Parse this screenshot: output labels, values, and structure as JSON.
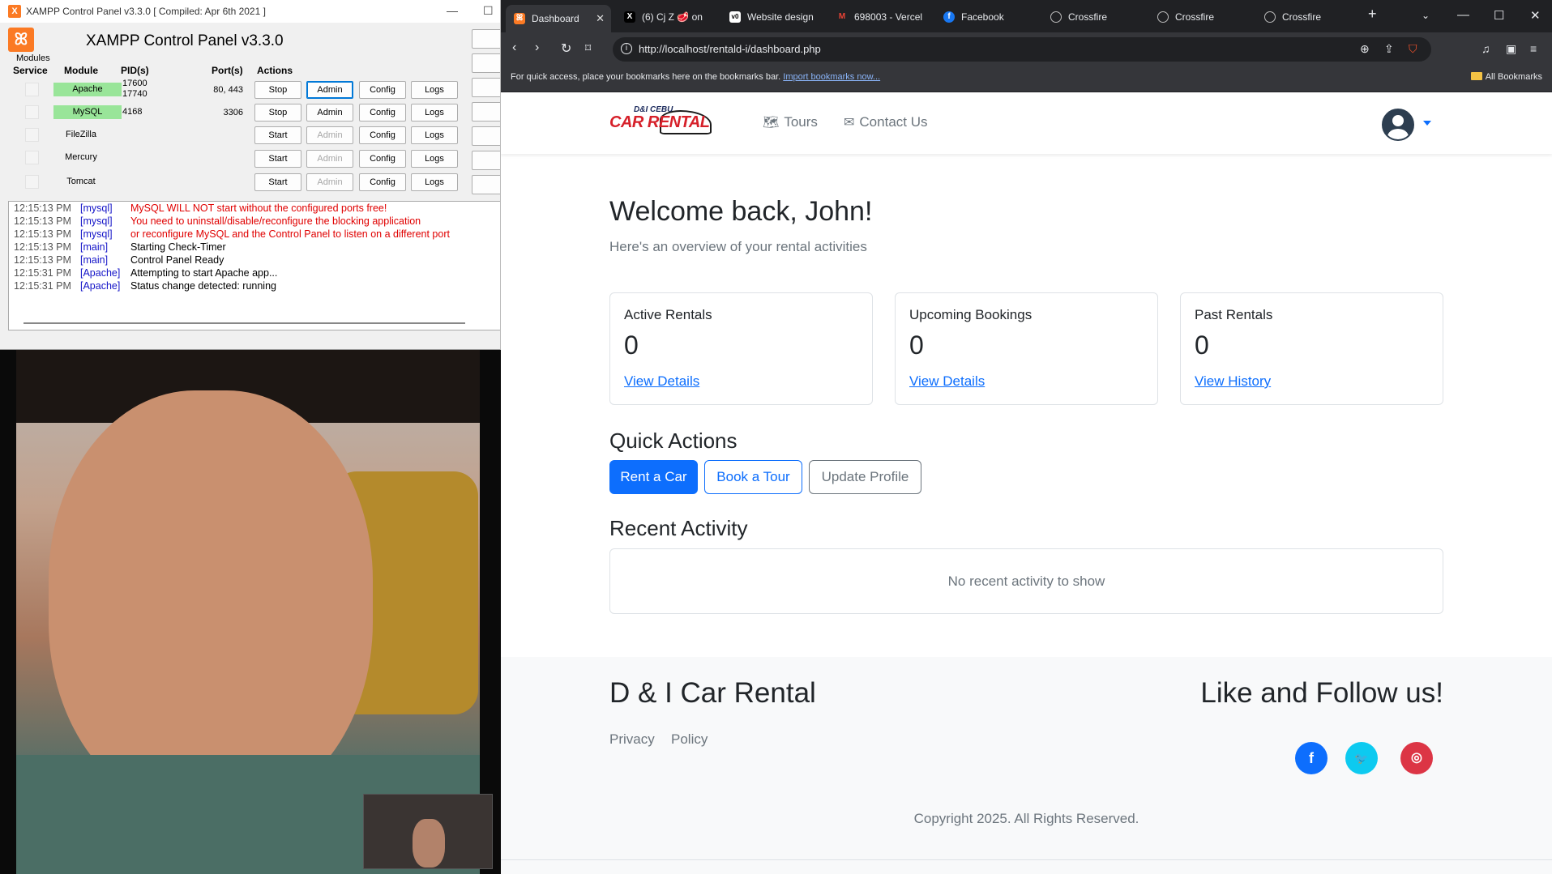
{
  "xampp": {
    "window_title": "XAMPP Control Panel v3.3.0   [ Compiled: Apr 6th 2021 ]",
    "title": "XAMPP Control Panel v3.3.0",
    "modules_label": "Modules",
    "headers": {
      "service": "Service",
      "module": "Module",
      "pids": "PID(s)",
      "ports": "Port(s)",
      "actions": "Actions"
    },
    "modules": [
      {
        "name": "Apache",
        "pid1": "17600",
        "pid2": "17740",
        "ports": "80, 443",
        "start_stop": "Stop",
        "admin": "Admin",
        "config": "Config",
        "logs": "Logs"
      },
      {
        "name": "MySQL",
        "pid1": "4168",
        "pid2": "",
        "ports": "3306",
        "start_stop": "Stop",
        "admin": "Admin",
        "config": "Config",
        "logs": "Logs"
      },
      {
        "name": "FileZilla",
        "pid1": "",
        "pid2": "",
        "ports": "",
        "start_stop": "Start",
        "admin": "Admin",
        "config": "Config",
        "logs": "Logs"
      },
      {
        "name": "Mercury",
        "pid1": "",
        "pid2": "",
        "ports": "",
        "start_stop": "Start",
        "admin": "Admin",
        "config": "Config",
        "logs": "Logs"
      },
      {
        "name": "Tomcat",
        "pid1": "",
        "pid2": "",
        "ports": "",
        "start_stop": "Start",
        "admin": "Admin",
        "config": "Config",
        "logs": "Logs"
      }
    ],
    "log": [
      {
        "time": "12:15:13 PM",
        "module": "[mysql]",
        "msg": "MySQL WILL NOT start without the configured ports free!"
      },
      {
        "time": "12:15:13 PM",
        "module": "[mysql]",
        "msg": "You need to uninstall/disable/reconfigure the blocking application"
      },
      {
        "time": "12:15:13 PM",
        "module": "[mysql]",
        "msg": "or reconfigure MySQL and the Control Panel to listen on a different port"
      },
      {
        "time": "12:15:13 PM",
        "module": "[main]",
        "msg": "Starting Check-Timer"
      },
      {
        "time": "12:15:13 PM",
        "module": "[main]",
        "msg": "Control Panel Ready"
      },
      {
        "time": "12:15:31 PM",
        "module": "[Apache]",
        "msg": "Attempting to start Apache app..."
      },
      {
        "time": "12:15:31 PM",
        "module": "[Apache]",
        "msg": "Status change detected: running"
      }
    ]
  },
  "browser": {
    "tabs": [
      {
        "label": "Dashboard",
        "icon": "xampp-icon"
      },
      {
        "label": "(6) Cj Z 🥩 on",
        "icon": "x-icon"
      },
      {
        "label": "Website design",
        "icon": "v0-icon"
      },
      {
        "label": "698003 - Vercel",
        "icon": "gmail-icon"
      },
      {
        "label": "Facebook",
        "icon": "facebook-icon"
      },
      {
        "label": "Crossfire",
        "icon": "globe-icon"
      },
      {
        "label": "Crossfire",
        "icon": "globe-icon"
      },
      {
        "label": "Crossfire",
        "icon": "globe-icon"
      }
    ],
    "url": "http://localhost/rentald-i/dashboard.php",
    "bookmarks_hint": "For quick access, place your bookmarks here on the bookmarks bar.",
    "import_link": "Import bookmarks now...",
    "all_bookmarks": "All Bookmarks"
  },
  "site": {
    "brand_sub": "D&I CEBU",
    "brand_main": "CAR RENTAL",
    "nav": {
      "tours": "Tours",
      "contact": "Contact Us"
    },
    "welcome": "Welcome back, John!",
    "subtitle": "Here's an overview of your rental activities",
    "cards": [
      {
        "title": "Active Rentals",
        "value": "0",
        "link": "View Details"
      },
      {
        "title": "Upcoming Bookings",
        "value": "0",
        "link": "View Details"
      },
      {
        "title": "Past Rentals",
        "value": "0",
        "link": "View History"
      }
    ],
    "quick_actions_title": "Quick Actions",
    "quick_actions": {
      "rent": "Rent a Car",
      "tour": "Book a Tour",
      "profile": "Update Profile"
    },
    "recent_title": "Recent Activity",
    "recent_empty": "No recent activity to show",
    "footer": {
      "brand": "D & I Car Rental",
      "links": [
        "Privacy",
        "Policy"
      ],
      "follow": "Like and Follow us!",
      "copyright": "Copyright 2025. All Rights Reserved."
    }
  },
  "colors": {
    "primary": "#0d6efd",
    "facebook": "#0d6efd",
    "twitter": "#0dcaf0",
    "instagram": "#dc3545",
    "xampp_orange": "#fb7a24",
    "running_green": "#99e599"
  }
}
